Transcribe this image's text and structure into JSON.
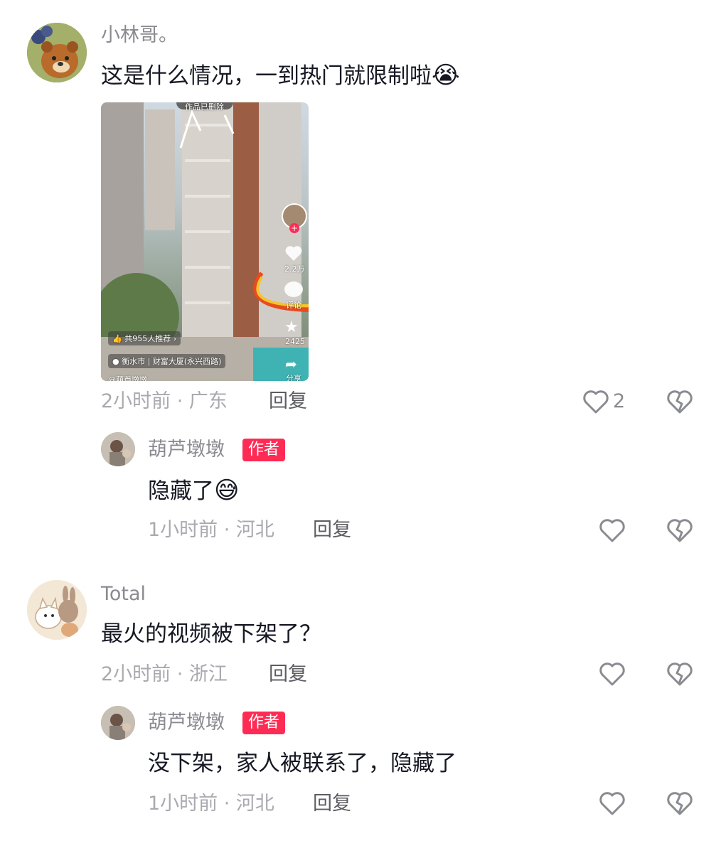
{
  "comments": [
    {
      "username": "小林哥。",
      "text": "这是什么情况，一到热门就限制啦",
      "emoji": "😭",
      "meta": "2小时前 · 广东",
      "reply_label": "回复",
      "like_count": "2",
      "video": {
        "banner": "作品已删除",
        "recommend": "共955人推荐",
        "location_city": "衡水市",
        "location_place": "财富大厦(永兴西路)",
        "author": "@葫芦墩墩",
        "likes": "2.2万",
        "comment_label": "评论",
        "favorites": "2425",
        "share_label": "分享"
      },
      "replies": [
        {
          "username": "葫芦墩墩",
          "author_tag": "作者",
          "text": "隐藏了",
          "emoji": "😅",
          "meta": "1小时前 · 河北",
          "reply_label": "回复"
        }
      ]
    },
    {
      "username": "Total",
      "text": "最火的视频被下架了？",
      "meta": "2小时前 · 浙江",
      "reply_label": "回复",
      "replies": [
        {
          "username": "葫芦墩墩",
          "author_tag": "作者",
          "text": "没下架，家人被联系了，隐藏了",
          "meta": "1小时前 · 河北",
          "reply_label": "回复"
        }
      ]
    }
  ],
  "icons": {
    "like": "heart-outline-icon",
    "dislike": "broken-heart-icon"
  },
  "colors": {
    "author_tag": "#fe2c55",
    "meta_text": "#a9aab0"
  }
}
